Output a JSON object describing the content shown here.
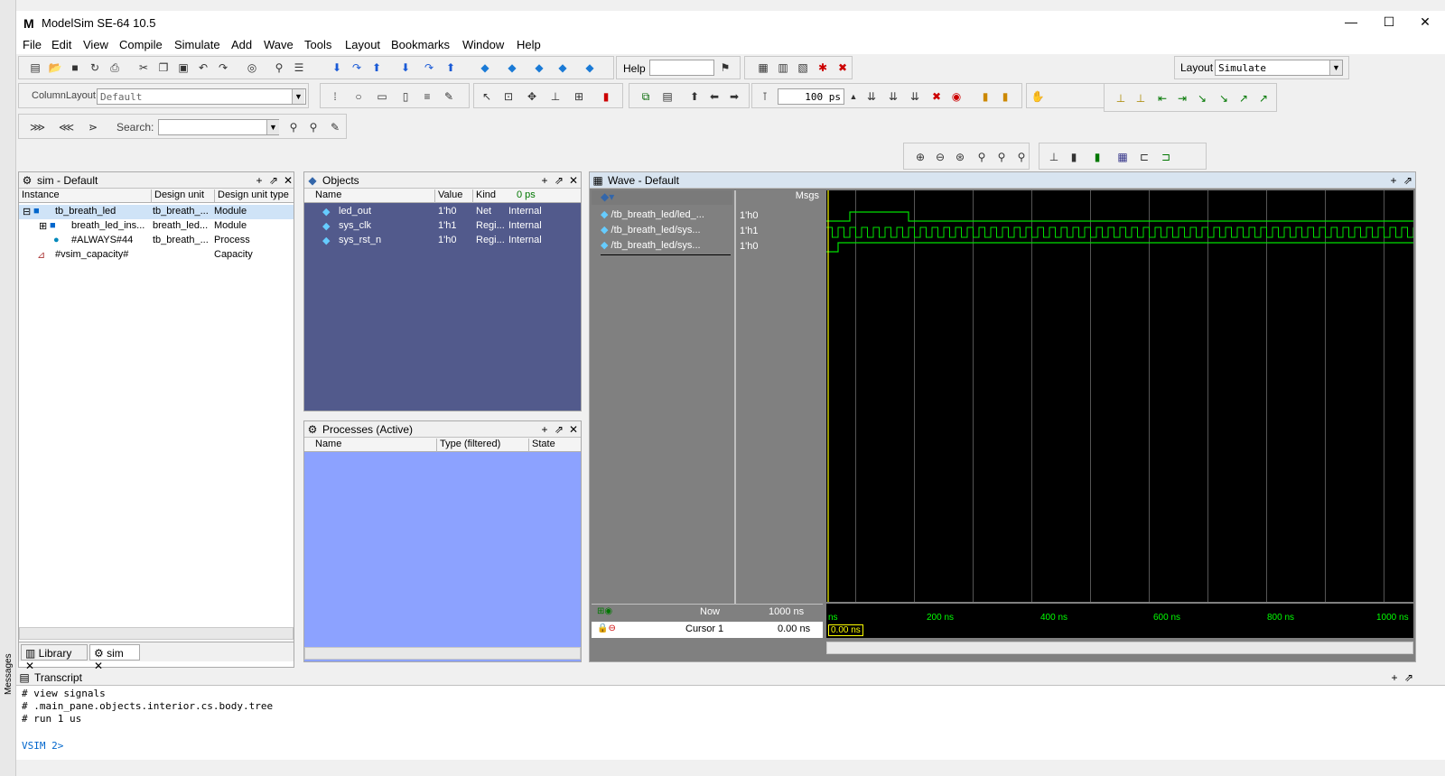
{
  "window": {
    "title": "ModelSim SE-64 10.5",
    "logo": "M"
  },
  "menu": [
    "File",
    "Edit",
    "View",
    "Compile",
    "Simulate",
    "Add",
    "Wave",
    "Tools",
    "Layout",
    "Bookmarks",
    "Window",
    "Help"
  ],
  "toolbar": {
    "help_label": "Help",
    "layout_label": "Layout",
    "layout_value": "Simulate",
    "column_layout_label": "ColumnLayout",
    "column_layout_value": "Default",
    "search_label": "Search:",
    "run_length": "100 ps"
  },
  "sim_pane": {
    "title": "sim - Default",
    "columns": [
      "Instance",
      "Design unit",
      "Design unit type"
    ],
    "rows": [
      {
        "instance": "tb_breath_led",
        "unit": "tb_breath_...",
        "type": "Module"
      },
      {
        "instance": "breath_led_ins...",
        "unit": "breath_led...",
        "type": "Module"
      },
      {
        "instance": "#ALWAYS#44",
        "unit": "tb_breath_...",
        "type": "Process"
      },
      {
        "instance": "#vsim_capacity#",
        "unit": "",
        "type": "Capacity"
      }
    ],
    "tabs": [
      "Library",
      "sim"
    ]
  },
  "objects_pane": {
    "title": "Objects",
    "columns": [
      "Name",
      "Value",
      "Kind"
    ],
    "now_label": "0 ps",
    "rows": [
      {
        "name": "led_out",
        "value": "1'h0",
        "kind": "Net",
        "mode": "Internal"
      },
      {
        "name": "sys_clk",
        "value": "1'h1",
        "kind": "Regi...",
        "mode": "Internal"
      },
      {
        "name": "sys_rst_n",
        "value": "1'h0",
        "kind": "Regi...",
        "mode": "Internal"
      }
    ]
  },
  "processes_pane": {
    "title": "Processes (Active)",
    "columns": [
      "Name",
      "Type (filtered)",
      "State"
    ]
  },
  "wave_pane": {
    "title": "Wave - Default",
    "msgs_label": "Msgs",
    "signals": [
      {
        "name": "/tb_breath_led/led_...",
        "value": "1'h0"
      },
      {
        "name": "/tb_breath_led/sys...",
        "value": "1'h1"
      },
      {
        "name": "/tb_breath_led/sys...",
        "value": "1'h0"
      }
    ],
    "now_label": "Now",
    "now_value": "1000 ns",
    "cursor_label": "Cursor 1",
    "cursor_value": "0.00 ns",
    "cursor_flag": "0.00 ns",
    "ruler": [
      "ns",
      "200 ns",
      "400 ns",
      "600 ns",
      "800 ns",
      "1000 ns"
    ]
  },
  "transcript": {
    "title": "Transcript",
    "lines": [
      "# view signals",
      "# .main_pane.objects.interior.cs.body.tree",
      "# run 1 us"
    ],
    "prompt": "VSIM 2>",
    "side_tab": "Messages"
  },
  "colors": {
    "wave_bg": "#000000",
    "wave_signal": "#00e000",
    "cursor": "#ffff00",
    "objects_bg": "#525a8c",
    "processes_bg": "#8ca2ff",
    "selected": "#cfe3f7"
  }
}
